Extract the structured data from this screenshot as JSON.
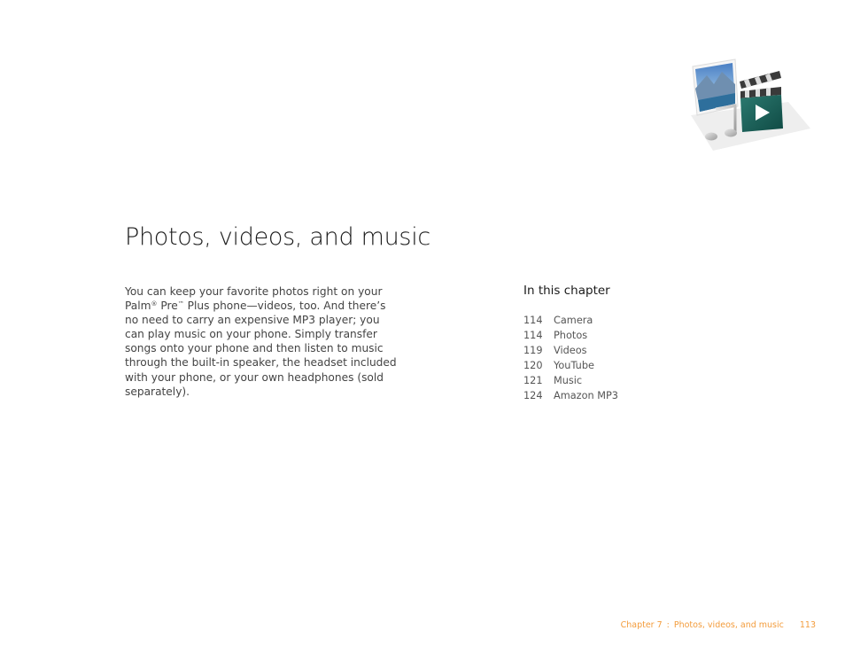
{
  "header": {
    "illustration": "photos-videos-music-icon"
  },
  "chapter": {
    "title": "Photos, videos, and music",
    "intro_parts": {
      "p1": "You can keep your favorite photos right on your Palm",
      "reg": "®",
      "p2": " Pre",
      "tm": "™",
      "p3": " Plus phone—videos, too. And there’s no need to carry an expensive MP3 player; you can play music on your phone. Simply transfer songs onto your phone and then listen to music through the built-in speaker, the headset included with your phone, or your own headphones (sold separately)."
    }
  },
  "toc": {
    "heading": "In this chapter",
    "items": [
      {
        "page": "114",
        "label": "Camera"
      },
      {
        "page": "114",
        "label": "Photos"
      },
      {
        "page": "119",
        "label": "Videos"
      },
      {
        "page": "120",
        "label": "YouTube"
      },
      {
        "page": "121",
        "label": "Music"
      },
      {
        "page": "124",
        "label": "Amazon MP3"
      }
    ]
  },
  "footer": {
    "chapter_label": "Chapter 7",
    "separator": ":",
    "section_title": "Photos, videos, and music",
    "page_number": "113",
    "accent_color": "#f39c3c"
  }
}
